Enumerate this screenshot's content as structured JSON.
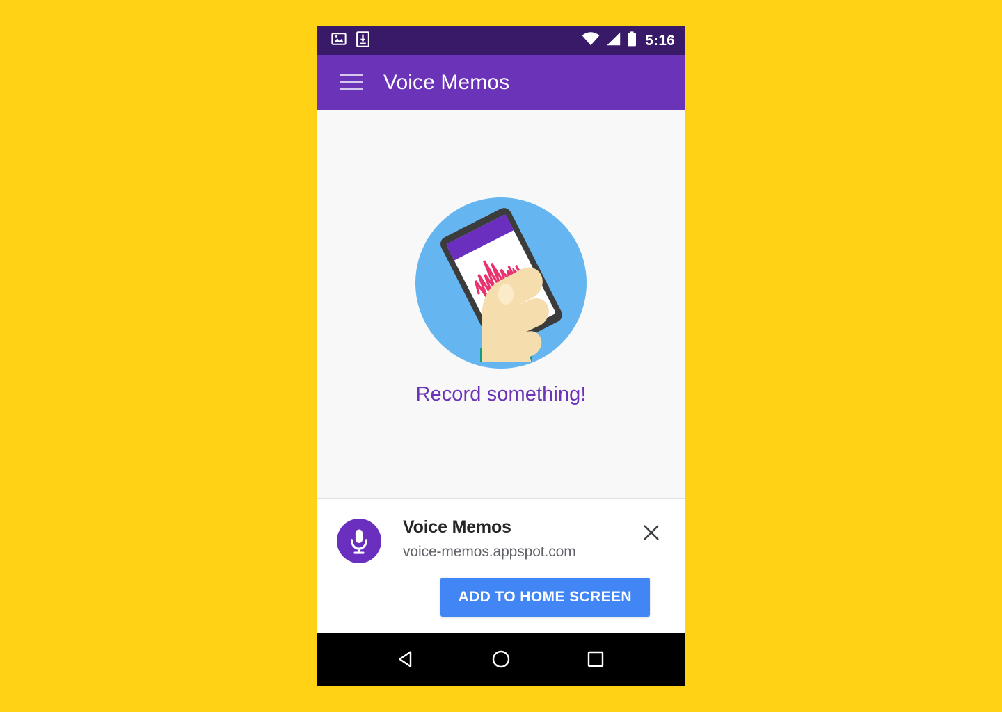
{
  "background_color": "#FFD215",
  "phone": {
    "status_bar": {
      "background_color": "#381A68",
      "time": "5:16",
      "left_icons": [
        {
          "name": "screenshot-icon",
          "label": "Screenshot captured"
        },
        {
          "name": "download-icon",
          "label": "Download complete"
        }
      ],
      "right_icons": [
        {
          "name": "wifi-icon",
          "label": "Wi-Fi connected"
        },
        {
          "name": "cellular-signal-icon",
          "label": "Cellular signal"
        },
        {
          "name": "battery-icon",
          "label": "Battery"
        }
      ]
    },
    "app_bar": {
      "background_color": "#6A33B8",
      "menu_label": "Menu",
      "title": "Voice Memos"
    },
    "content": {
      "background_color": "#F8F8F8",
      "illustration": {
        "name": "hand-holding-phone-illustration",
        "circle_color": "#64B5F0",
        "phone_body_color": "#3C3C3C",
        "phone_screen_color": "#FFFFFF",
        "phone_app_bar_color": "#6A2FBF",
        "waveform_color": "#E8336E",
        "skin_color": "#F6DDAE",
        "sleeve_color": "#159C7E"
      },
      "empty_message": "Record something!",
      "empty_message_color": "#6A33B8"
    },
    "install_banner": {
      "app_icon": {
        "name": "microphone-icon",
        "background_color": "#6A2FBF",
        "glyph_color": "#FFFFFF"
      },
      "title": "Voice Memos",
      "url": "voice-memos.appspot.com",
      "close_label": "Close",
      "install_button_label": "ADD TO HOME SCREEN",
      "install_button_color": "#4285F4"
    },
    "nav_bar": {
      "background_color": "#000000",
      "buttons": [
        {
          "name": "back-button",
          "label": "Back"
        },
        {
          "name": "home-button",
          "label": "Home"
        },
        {
          "name": "recents-button",
          "label": "Recent apps"
        }
      ]
    }
  }
}
